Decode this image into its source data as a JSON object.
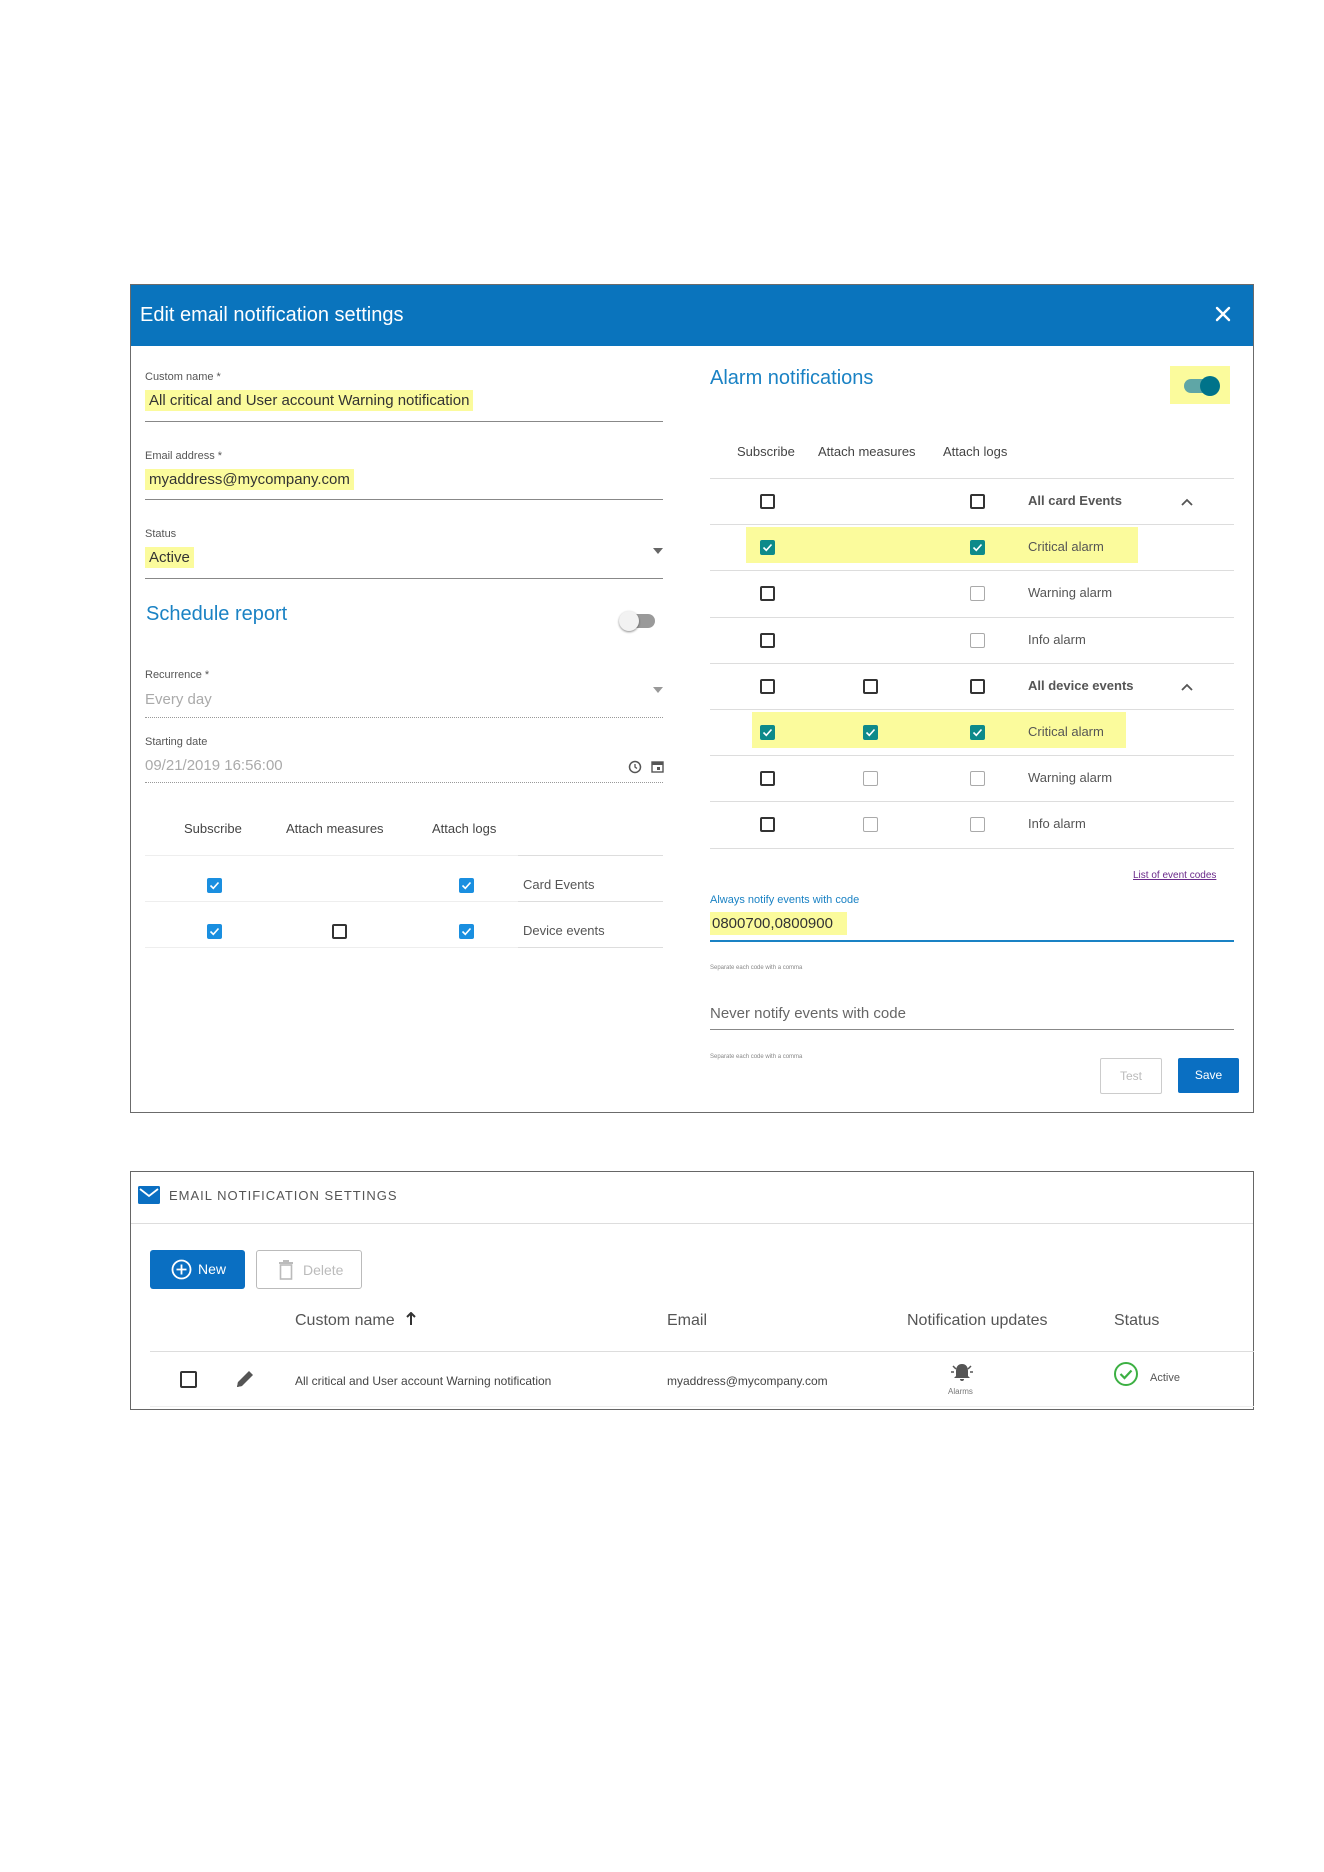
{
  "dialog": {
    "title": "Edit email notification settings",
    "custom_name": {
      "label": "Custom name *",
      "value": "All critical and User account Warning notification"
    },
    "email": {
      "label": "Email address *",
      "value": "myaddress@mycompany.com"
    },
    "status": {
      "label": "Status",
      "value": "Active"
    },
    "schedule": {
      "title": "Schedule report",
      "enabled": false,
      "recurrence": {
        "label": "Recurrence *",
        "value": "Every day"
      },
      "starting_date": {
        "label": "Starting date",
        "value": "09/21/2019 16:56:00"
      },
      "columns": [
        "Subscribe",
        "Attach measures",
        "Attach logs"
      ],
      "rows": [
        {
          "label": "Card Events",
          "subscribe": true,
          "measures": null,
          "logs": true
        },
        {
          "label": "Device events",
          "subscribe": true,
          "measures": false,
          "logs": true
        }
      ]
    },
    "alarms": {
      "title": "Alarm notifications",
      "enabled": true,
      "columns": [
        "Subscribe",
        "Attach measures",
        "Attach logs"
      ],
      "groups": [
        {
          "label": "All card Events",
          "rows": [
            {
              "label": "Critical alarm",
              "subscribe": true,
              "logs": true
            },
            {
              "label": "Warning alarm",
              "subscribe": false,
              "logs": false
            },
            {
              "label": "Info alarm",
              "subscribe": false,
              "logs": false
            }
          ]
        },
        {
          "label": "All device events",
          "rows": [
            {
              "label": "Critical alarm",
              "subscribe": true,
              "measures": true,
              "logs": true
            },
            {
              "label": "Warning alarm",
              "subscribe": false,
              "measures": false,
              "logs": false
            },
            {
              "label": "Info alarm",
              "subscribe": false,
              "measures": false,
              "logs": false
            }
          ]
        }
      ],
      "event_codes_link": "List of event codes",
      "always_notify": {
        "label": "Always notify events with code",
        "value": "0800700,0800900",
        "hint": "Separate each code with a comma"
      },
      "never_notify": {
        "placeholder": "Never notify events with code",
        "hint": "Separate each code with a comma"
      }
    },
    "buttons": {
      "test": "Test",
      "save": "Save"
    }
  },
  "list_panel": {
    "title": "EMAIL NOTIFICATION SETTINGS",
    "new_label": "New",
    "delete_label": "Delete",
    "columns": {
      "name": "Custom name",
      "email": "Email",
      "updates": "Notification updates",
      "status": "Status"
    },
    "rows": [
      {
        "name": "All critical and User account Warning notification",
        "email": "myaddress@mycompany.com",
        "updates": "Alarms",
        "status": "Active"
      }
    ]
  },
  "colors": {
    "header": "#0a74bd",
    "accent": "#1a82c4",
    "highlight": "#fbfb9c",
    "check": "#1a8fe0",
    "check_teal": "#0d8a8a",
    "status_ok": "#3cb043"
  }
}
